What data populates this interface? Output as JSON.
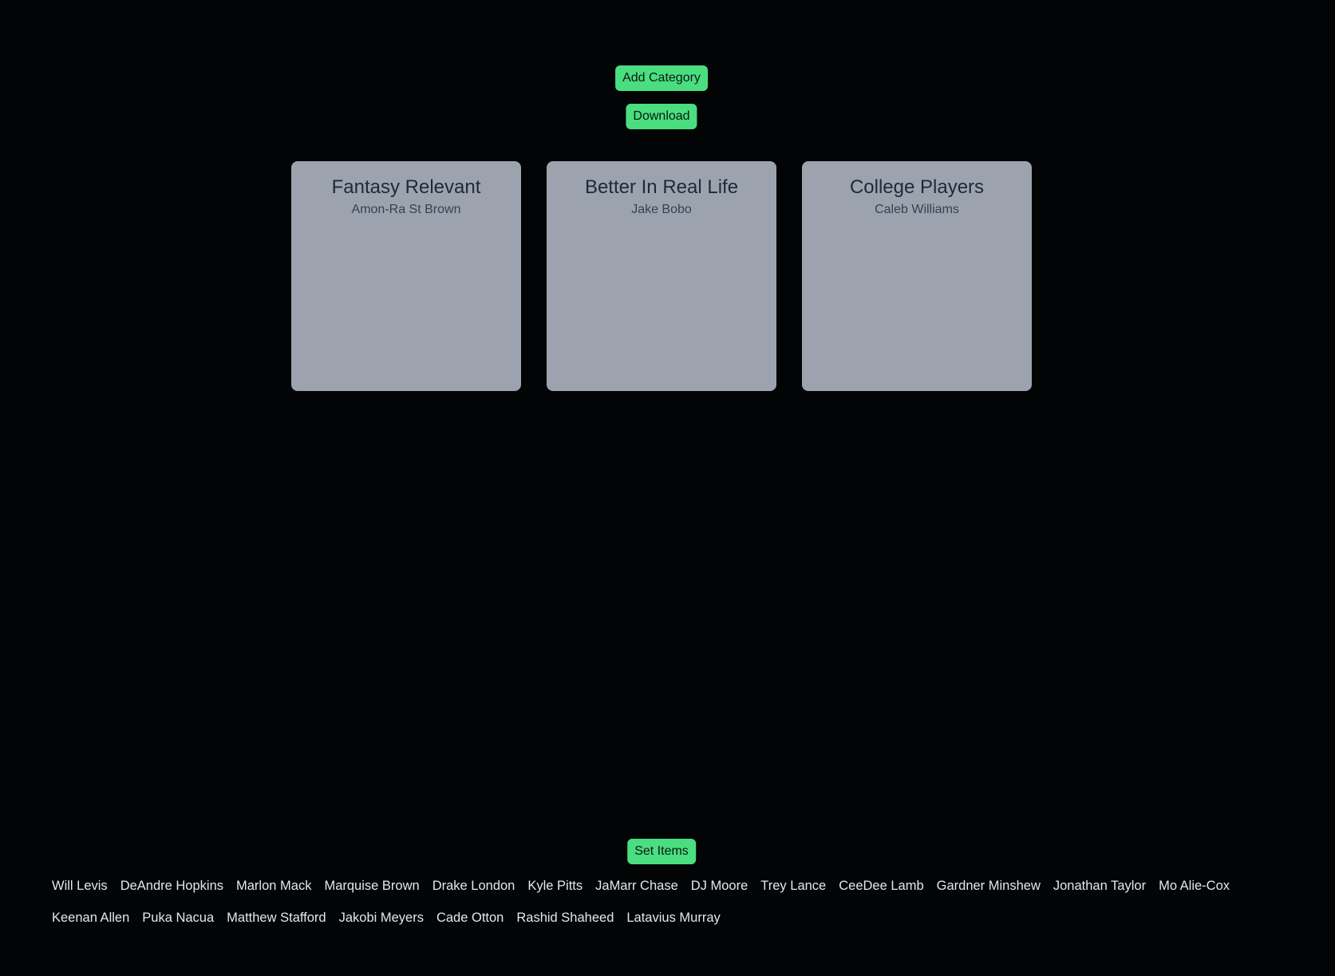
{
  "toolbar": {
    "add_category_label": "Add Category",
    "download_label": "Download",
    "set_items_label": "Set Items"
  },
  "categories": [
    {
      "title": "Fantasy Relevant",
      "items": [
        "Amon-Ra St Brown"
      ]
    },
    {
      "title": "Better In Real Life",
      "items": [
        "Jake Bobo"
      ]
    },
    {
      "title": "College Players",
      "items": [
        "Caleb Williams"
      ]
    }
  ],
  "pool": [
    "Will Levis",
    "DeAndre Hopkins",
    "Marlon Mack",
    "Marquise Brown",
    "Drake London",
    "Kyle Pitts",
    "JaMarr Chase",
    "DJ Moore",
    "Trey Lance",
    "CeeDee Lamb",
    "Gardner Minshew",
    "Jonathan Taylor",
    "Mo Alie-Cox",
    "Keenan Allen",
    "Puka Nacua",
    "Matthew Stafford",
    "Jakobi Meyers",
    "Cade Otton",
    "Rashid Shaheed",
    "Latavius Murray"
  ],
  "colors": {
    "background": "#030405",
    "accent": "#4ade80",
    "card": "#9ca3af"
  }
}
